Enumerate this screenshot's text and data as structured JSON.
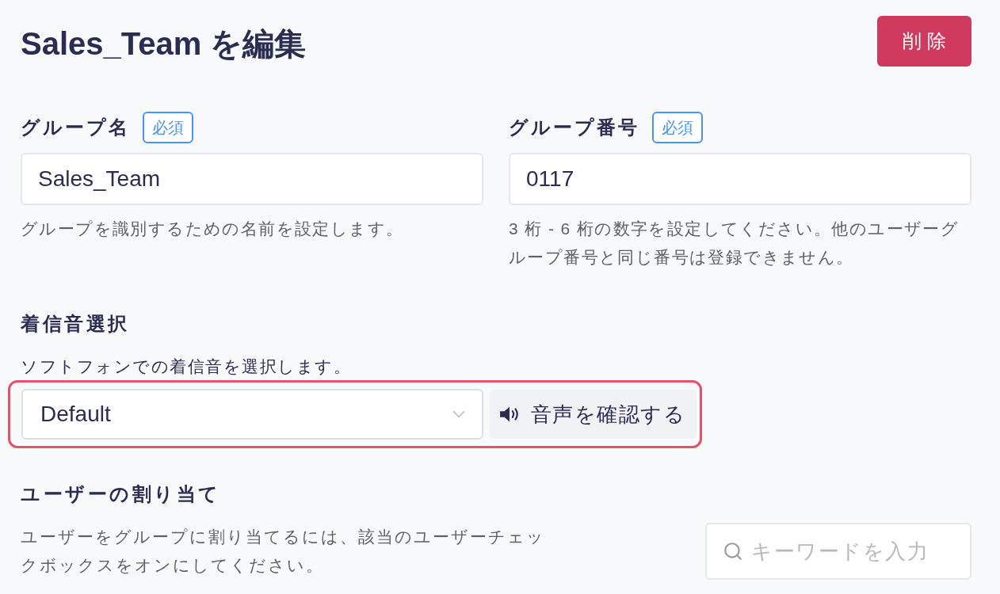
{
  "header": {
    "title": "Sales_Team を編集",
    "delete_button": "削除"
  },
  "fields": [
    {
      "label": "グループ名",
      "badge": "必須",
      "value": "Sales_Team",
      "help": "グループを識別するための名前を設定します。"
    },
    {
      "label": "グループ番号",
      "badge": "必須",
      "value": "0117",
      "help": "3 桁 - 6 桁の数字を設定してください。他のユーザーグループ番号と同じ番号は登録できません。"
    }
  ],
  "ringtone": {
    "title": "着信音選択",
    "description": "ソフトフォンでの着信音を選択します。",
    "highlighted": true,
    "select": {
      "value": "Default"
    },
    "preview_button": "音声を確認する"
  },
  "user_assignment": {
    "title": "ユーザーの割り当て",
    "description": "ユーザーをグループに割り当てるには、該当のユーザーチェックボックスをオンにしてください。",
    "search": {
      "placeholder": "キーワードを入力"
    }
  }
}
